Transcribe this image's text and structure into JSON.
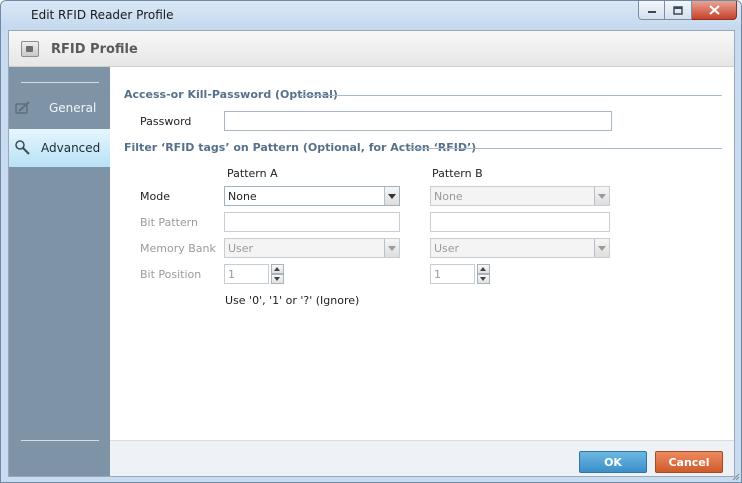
{
  "window": {
    "title": "Edit RFID Reader Profile"
  },
  "header": {
    "title": "RFID Profile",
    "icon": "rfid-profile-icon"
  },
  "sidebar": {
    "items": [
      {
        "label": "General",
        "icon": "general-settings-icon",
        "selected": false
      },
      {
        "label": "Advanced",
        "icon": "advanced-settings-icon",
        "selected": true
      }
    ]
  },
  "access": {
    "section_title": "Access-or Kill-Password (Optional)",
    "password_label": "Password",
    "password_value": ""
  },
  "filter": {
    "section_title": "Filter ‘RFID tags’ on Pattern (Optional, for Action ‘RFID’)",
    "pattern_a_header": "Pattern A",
    "pattern_b_header": "Pattern B",
    "labels": {
      "mode": "Mode",
      "bit_pattern": "Bit Pattern",
      "memory_bank": "Memory Bank",
      "bit_position": "Bit Position"
    },
    "pattern_a": {
      "mode": "None",
      "bit_pattern": "",
      "memory_bank": "User",
      "bit_position": "1"
    },
    "pattern_b": {
      "mode": "None",
      "bit_pattern": "",
      "memory_bank": "User",
      "bit_position": "1"
    },
    "hint": "Use  '0', '1' or '?' (Ignore)"
  },
  "footer": {
    "ok_label": "OK",
    "cancel_label": "Cancel"
  },
  "colors": {
    "ok": "#3a8fc8",
    "cancel": "#cf5a2c",
    "section_title": "#57708b",
    "sidebar": "#7f93a6"
  }
}
